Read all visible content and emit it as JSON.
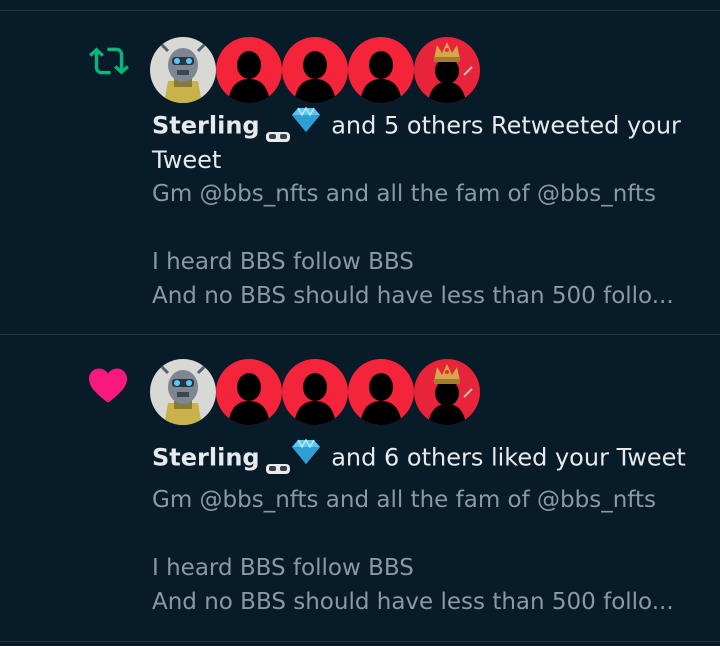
{
  "colors": {
    "background": "#081b29",
    "retweet": "#00ba7c",
    "like": "#f91880",
    "avatar_red": "#f4243b",
    "muted_text": "#8b98a5",
    "primary_text": "#e7e9ea"
  },
  "notifications": [
    {
      "type_icon": "retweet-icon",
      "avatars": [
        "robot-avatar",
        "silhouette-avatar",
        "silhouette-avatar",
        "silhouette-avatar",
        "crowned-avatar"
      ],
      "actor_name": "Sterling",
      "actor_badges": [
        "vr-glasses-emoji",
        "gem-emoji"
      ],
      "action_text": "and 5 others Retweeted your Tweet",
      "tweet_lines": [
        "Gm @bbs_nfts and all the fam of @bbs_nfts",
        "",
        "I heard BBS follow BBS",
        "And no BBS should have less than 500 follo..."
      ]
    },
    {
      "type_icon": "heart-icon",
      "avatars": [
        "robot-avatar",
        "silhouette-avatar",
        "silhouette-avatar",
        "silhouette-avatar",
        "crowned-avatar"
      ],
      "actor_name": "Sterling",
      "actor_badges": [
        "vr-glasses-emoji",
        "gem-emoji"
      ],
      "action_text": "and 6 others liked your Tweet",
      "tweet_lines": [
        "Gm @bbs_nfts and all the fam of @bbs_nfts",
        "",
        "I heard BBS follow BBS",
        "And no BBS should have less than 500 follo..."
      ]
    }
  ]
}
